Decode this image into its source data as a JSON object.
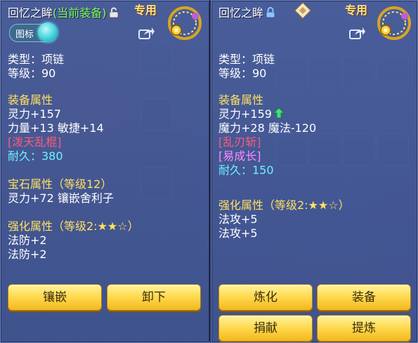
{
  "left": {
    "title_name": "回忆之眸",
    "title_status": "(当前装备)",
    "exclusive_label": "专用",
    "toggle_label": "图标",
    "type_line": "类型：项链",
    "level_line": "等级：90",
    "attr_header": "装备属性",
    "attrs": [
      "灵力+157",
      "力量+13 敏捷+14"
    ],
    "special_skill": "[泼天乱棍]",
    "durability": "耐久：380",
    "gem_header": "宝石属性（等级12）",
    "gem_line": "灵力+72 镶嵌舍利子",
    "strengthen_header": "强化属性（等级2:★★☆）",
    "strengthen_lines": [
      "法防+2",
      "法防+2"
    ],
    "buttons": [
      "镶嵌",
      "卸下"
    ]
  },
  "right": {
    "title_name": "回忆之眸",
    "exclusive_label": "专用",
    "type_line": "类型：项链",
    "level_line": "等级：90",
    "attr_header": "装备属性",
    "attrs": [
      "灵力+159",
      "魔力+28 魔法-120"
    ],
    "special_skill": "[乱刃斩]",
    "special_effect": "[易成长]",
    "durability": "耐久：150",
    "strengthen_header": "强化属性（等级2:★★☆）",
    "strengthen_lines": [
      "法攻+5",
      "法攻+5"
    ],
    "buttons": [
      "炼化",
      "装备",
      "捐献",
      "提炼"
    ]
  },
  "colors": {
    "section": "#ffe060",
    "skill": "#ff5a7a",
    "effect": "#ff8aff",
    "durability": "#6ef0ff",
    "equipped": "#7cff5a",
    "button": "#ffd84a"
  },
  "icons": [
    "lock-open-icon",
    "lock-closed-icon",
    "share-icon",
    "necklace-icon",
    "arrow-up-icon",
    "diamond-badge-icon"
  ]
}
